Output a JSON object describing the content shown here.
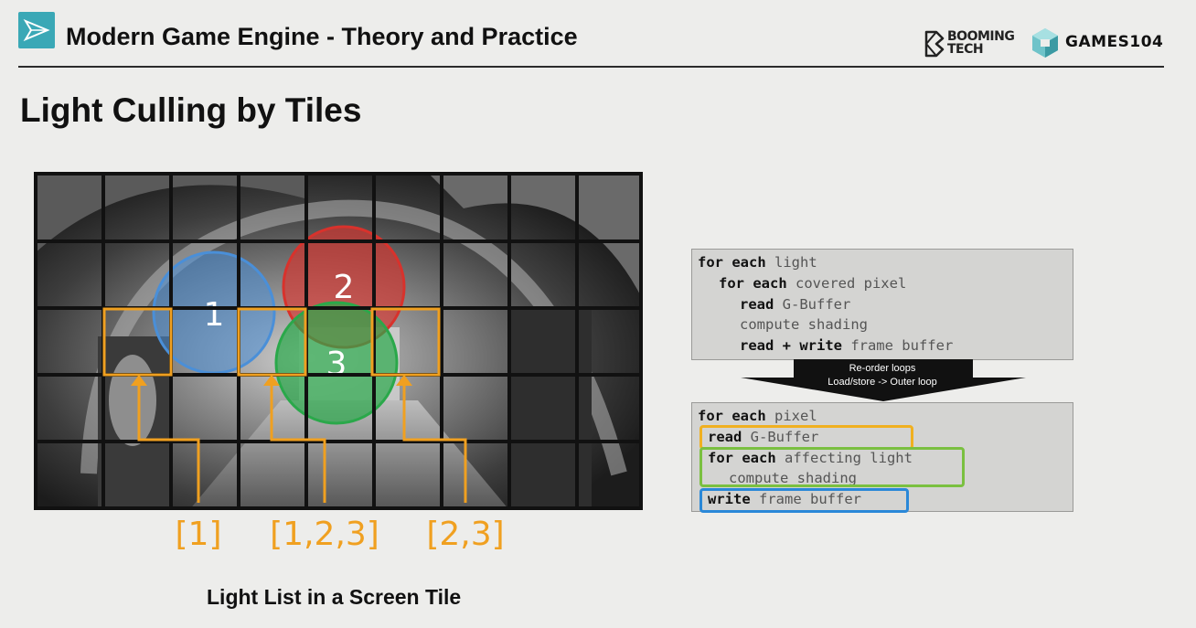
{
  "header": {
    "course_title": "Modern Game Engine - Theory and Practice",
    "booming_line1": "BOOMING",
    "booming_line2": "TECH",
    "games_label": "GAMES104"
  },
  "slide": {
    "title": "Light Culling by Tiles",
    "caption": "Light List in a Screen Tile"
  },
  "figure": {
    "lights": [
      {
        "label": "1",
        "color": "#4a8fd8"
      },
      {
        "label": "2",
        "color": "#d8322c"
      },
      {
        "label": "3",
        "color": "#2aa84a"
      }
    ],
    "tile_highlight_color": "#f0a020",
    "tile_lists": [
      "[1]",
      "[1,2,3]",
      "[2,3]"
    ]
  },
  "code_before": {
    "lines": [
      {
        "kw": "for each",
        "rest": " light"
      },
      {
        "kw": "for each",
        "rest": " covered pixel"
      },
      {
        "kw": "read",
        "rest": " G-Buffer"
      },
      {
        "kw": "",
        "rest": "compute shading"
      },
      {
        "kw": "read + write",
        "rest": " frame buffer"
      }
    ]
  },
  "transform_arrow": {
    "line1": "Re-order loops",
    "line2": "Load/store -> Outer loop"
  },
  "code_after": {
    "lines": [
      {
        "kw": "for each",
        "rest": " pixel"
      },
      {
        "kw": "read",
        "rest": " G-Buffer"
      },
      {
        "kw": "for each",
        "rest": " affecting light"
      },
      {
        "kw": "",
        "rest": "compute shading"
      },
      {
        "kw": "write",
        "rest": " frame buffer"
      }
    ],
    "highlight_colors": {
      "read": "#f0b020",
      "loop": "#7ac040",
      "write": "#2a88d8"
    }
  }
}
